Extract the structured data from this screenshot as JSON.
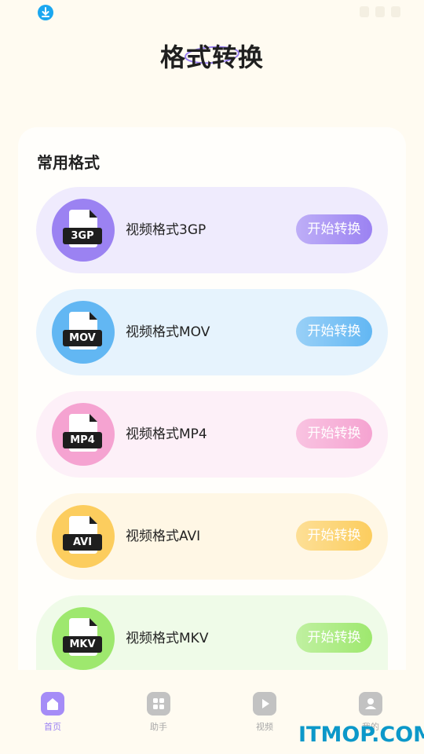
{
  "header": {
    "title": "格式转换"
  },
  "section": {
    "title": "常用格式"
  },
  "formats": [
    {
      "tag": "3GP",
      "label": "视频格式3GP",
      "button": "开始转换",
      "color": "#9b82f2"
    },
    {
      "tag": "MOV",
      "label": "视频格式MOV",
      "button": "开始转换",
      "color": "#62b7f3"
    },
    {
      "tag": "MP4",
      "label": "视频格式MP4",
      "button": "开始转换",
      "color": "#f5a3d1"
    },
    {
      "tag": "AVI",
      "label": "视频格式AVI",
      "button": "开始转换",
      "color": "#fccd5e"
    },
    {
      "tag": "MKV",
      "label": "视频格式MKV",
      "button": "开始转换",
      "color": "#9ee86e"
    }
  ],
  "nav": [
    {
      "label": "首页",
      "icon": "home-icon",
      "active": true
    },
    {
      "label": "助手",
      "icon": "grid-icon",
      "active": false
    },
    {
      "label": "视频",
      "icon": "play-icon",
      "active": false
    },
    {
      "label": "我的",
      "icon": "user-icon",
      "active": false
    }
  ],
  "watermark": "ITMOP.COM",
  "colors": {
    "background": "#fffbf1",
    "accent": "#9b82f2",
    "status_icon": "#1ba7f0"
  }
}
